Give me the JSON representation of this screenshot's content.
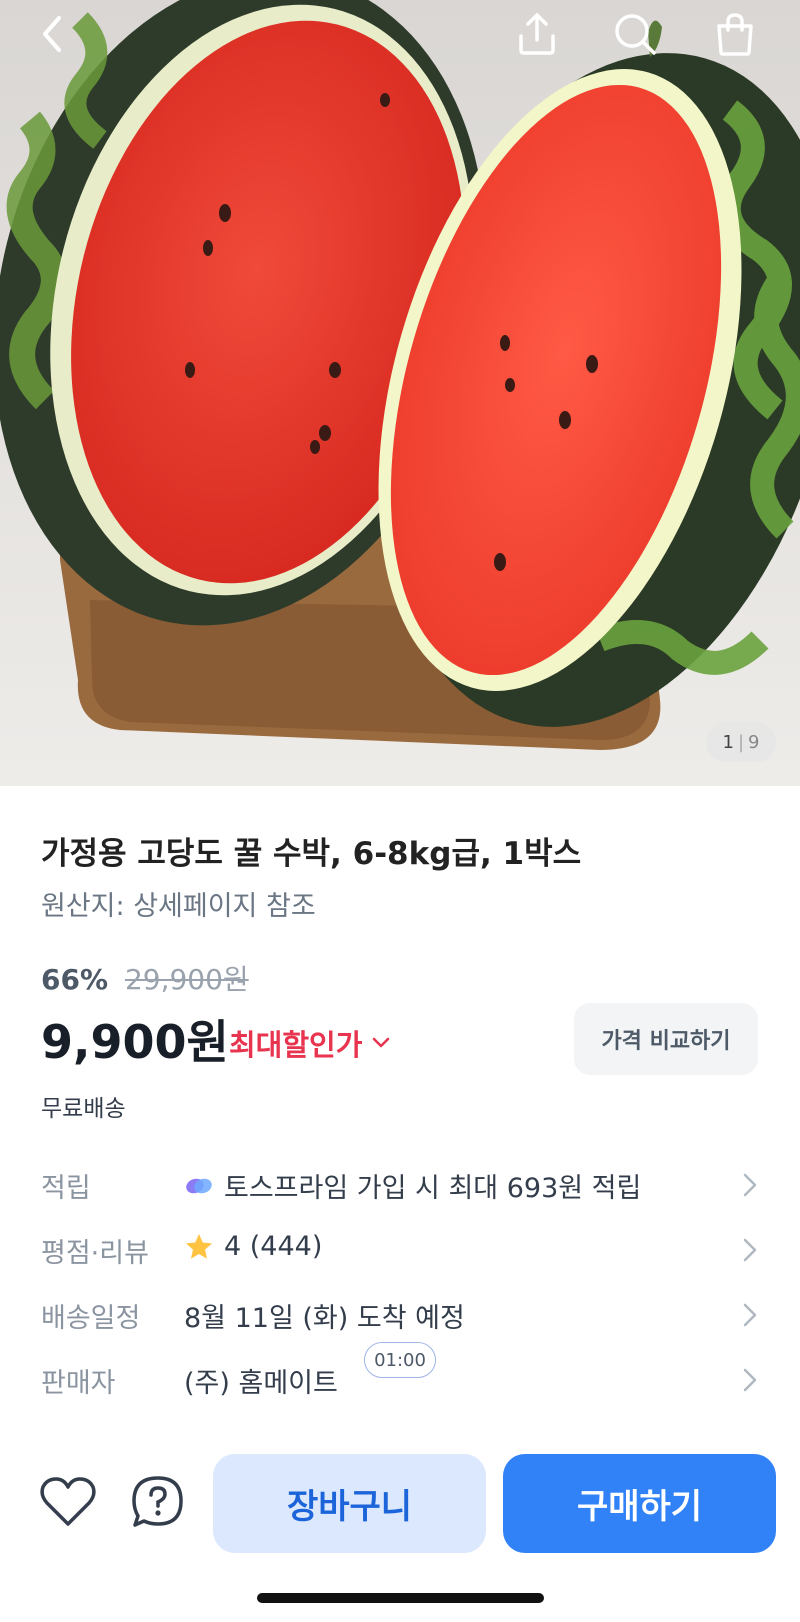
{
  "hero": {
    "image_desc": "watermelon-halves-on-cutting-board",
    "counter_current": "1",
    "counter_total": "9"
  },
  "topbar": {
    "icons": [
      "back-icon",
      "share-icon",
      "search-icon",
      "shopping-bag-icon"
    ]
  },
  "product": {
    "title": "가정용 고당도 꿀 수박, 6-8kg급, 1박스",
    "origin": "원산지: 상세페이지 참조",
    "discount_rate": "66%",
    "original_price": "29,900원",
    "price": "9,900원",
    "max_discount_label": "최대할인가",
    "compare_button": "가격 비교하기",
    "shipping": "무료배송"
  },
  "info": {
    "points_label": "적립",
    "points_value": "토스프라임 가입 시 최대 693원 적립",
    "rating_label": "평점·리뷰",
    "rating_value": "4 (444)",
    "delivery_label": "배송일정",
    "delivery_value": "8월 11일 (화) 도착 예정",
    "seller_label": "판매자",
    "seller_value": "(주) 홈메이트",
    "timer": "01:00"
  },
  "actions": {
    "cart": "장바구니",
    "buy": "구매하기"
  },
  "colors": {
    "accent": "#3182f6",
    "discount_red": "#e8344e",
    "cart_bg": "#dbe8fd",
    "star": "#ffc342"
  }
}
